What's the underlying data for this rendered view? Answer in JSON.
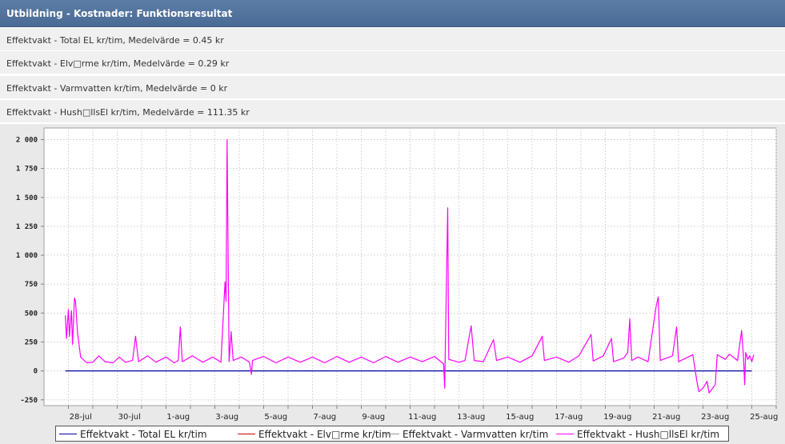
{
  "panel": {
    "title": "Utbildning - Kostnader: Funktionsresultat"
  },
  "summary_rows": [
    "Effektvakt - Total EL kr/tim, Medelvärde = 0.45 kr",
    "Effektvakt - Elv□rme kr/tim, Medelvärde = 0.29 kr",
    "Effektvakt - Varmvatten kr/tim, Medelvärde = 0 kr",
    "Effektvakt - Hush□llsEl kr/tim, Medelvärde = 111.35 kr"
  ],
  "chart_data": {
    "type": "line",
    "x_unit": "day",
    "x_tick_labels": [
      "28-jul",
      "30-jul",
      "1-aug",
      "3-aug",
      "5-aug",
      "7-aug",
      "9-aug",
      "11-aug",
      "13-aug",
      "15-aug",
      "17-aug",
      "19-aug",
      "21-aug",
      "23-aug",
      "25-aug"
    ],
    "x_range": [
      "2023-07-26T12:00",
      "2023-08-25T12:00"
    ],
    "y_ticks": [
      2000,
      1750,
      1500,
      1250,
      1000,
      750,
      500,
      250,
      0,
      -250
    ],
    "y_tick_labels": [
      "2 000",
      "1 750",
      "1 500",
      "1 250",
      "1 000",
      "750",
      "500",
      "250",
      "0",
      "-250"
    ],
    "ylim": [
      -300,
      2100
    ],
    "grid": true,
    "legend_position": "bottom",
    "series": [
      {
        "name": "Effektvakt - Total EL kr/tim",
        "color": "#0000a0",
        "points": [
          [
            "2023-07-27T09:00",
            0
          ],
          [
            "2023-08-24T12:00",
            0
          ]
        ]
      },
      {
        "name": "Effektvakt - Elv□rme kr/tim",
        "color": "#cc0000",
        "points": []
      },
      {
        "name": "Effektvakt - Varmvatten kr/tim",
        "color": "#999999",
        "points": []
      },
      {
        "name": "Effektvakt - Hush□llsEl kr/tim",
        "color": "#ff00ff",
        "points": [
          [
            "2023-07-27T09:00",
            480
          ],
          [
            "2023-07-27T10:00",
            280
          ],
          [
            "2023-07-27T12:00",
            530
          ],
          [
            "2023-07-27T13:00",
            300
          ],
          [
            "2023-07-27T15:00",
            520
          ],
          [
            "2023-07-27T16:00",
            230
          ],
          [
            "2023-07-27T18:00",
            630
          ],
          [
            "2023-07-27T19:00",
            600
          ],
          [
            "2023-07-27T21:00",
            330
          ],
          [
            "2023-07-28T00:00",
            120
          ],
          [
            "2023-07-28T06:00",
            70
          ],
          [
            "2023-07-28T12:00",
            75
          ],
          [
            "2023-07-28T18:00",
            130
          ],
          [
            "2023-07-29T00:00",
            80
          ],
          [
            "2023-07-29T08:00",
            70
          ],
          [
            "2023-07-29T14:00",
            120
          ],
          [
            "2023-07-29T20:00",
            75
          ],
          [
            "2023-07-30T03:00",
            90
          ],
          [
            "2023-07-30T06:00",
            300
          ],
          [
            "2023-07-30T09:00",
            80
          ],
          [
            "2023-07-30T18:00",
            130
          ],
          [
            "2023-07-31T02:00",
            75
          ],
          [
            "2023-07-31T12:00",
            120
          ],
          [
            "2023-07-31T20:00",
            70
          ],
          [
            "2023-08-01T00:00",
            90
          ],
          [
            "2023-08-01T02:00",
            380
          ],
          [
            "2023-08-01T04:00",
            80
          ],
          [
            "2023-08-01T14:00",
            130
          ],
          [
            "2023-08-02T00:00",
            75
          ],
          [
            "2023-08-02T10:00",
            120
          ],
          [
            "2023-08-02T18:00",
            75
          ],
          [
            "2023-08-02T22:00",
            770
          ],
          [
            "2023-08-02T23:00",
            600
          ],
          [
            "2023-08-03T00:00",
            2000
          ],
          [
            "2023-08-03T02:00",
            80
          ],
          [
            "2023-08-03T04:00",
            340
          ],
          [
            "2023-08-03T06:00",
            90
          ],
          [
            "2023-08-03T14:00",
            120
          ],
          [
            "2023-08-03T22:00",
            75
          ],
          [
            "2023-08-04T00:00",
            -30
          ],
          [
            "2023-08-04T01:00",
            90
          ],
          [
            "2023-08-04T12:00",
            125
          ],
          [
            "2023-08-05T00:00",
            70
          ],
          [
            "2023-08-05T12:00",
            120
          ],
          [
            "2023-08-06T00:00",
            75
          ],
          [
            "2023-08-06T12:00",
            120
          ],
          [
            "2023-08-07T00:00",
            70
          ],
          [
            "2023-08-07T12:00",
            125
          ],
          [
            "2023-08-08T00:00",
            75
          ],
          [
            "2023-08-08T12:00",
            120
          ],
          [
            "2023-08-09T00:00",
            70
          ],
          [
            "2023-08-09T12:00",
            125
          ],
          [
            "2023-08-10T00:00",
            75
          ],
          [
            "2023-08-10T12:00",
            120
          ],
          [
            "2023-08-11T00:00",
            80
          ],
          [
            "2023-08-11T12:00",
            125
          ],
          [
            "2023-08-11T21:00",
            60
          ],
          [
            "2023-08-11T22:00",
            -150
          ],
          [
            "2023-08-11T23:00",
            400
          ],
          [
            "2023-08-12T01:00",
            1410
          ],
          [
            "2023-08-12T02:00",
            100
          ],
          [
            "2023-08-12T12:00",
            75
          ],
          [
            "2023-08-12T18:00",
            90
          ],
          [
            "2023-08-13T00:00",
            390
          ],
          [
            "2023-08-13T03:00",
            90
          ],
          [
            "2023-08-13T12:00",
            80
          ],
          [
            "2023-08-13T22:00",
            270
          ],
          [
            "2023-08-14T01:00",
            90
          ],
          [
            "2023-08-14T12:00",
            120
          ],
          [
            "2023-08-15T00:00",
            75
          ],
          [
            "2023-08-15T12:00",
            130
          ],
          [
            "2023-08-15T22:00",
            300
          ],
          [
            "2023-08-16T00:00",
            90
          ],
          [
            "2023-08-16T12:00",
            120
          ],
          [
            "2023-08-17T00:00",
            75
          ],
          [
            "2023-08-17T10:00",
            130
          ],
          [
            "2023-08-17T22:00",
            315
          ],
          [
            "2023-08-18T00:00",
            85
          ],
          [
            "2023-08-18T10:00",
            130
          ],
          [
            "2023-08-18T18:00",
            280
          ],
          [
            "2023-08-18T20:00",
            80
          ],
          [
            "2023-08-19T06:00",
            110
          ],
          [
            "2023-08-19T10:00",
            160
          ],
          [
            "2023-08-19T12:00",
            450
          ],
          [
            "2023-08-19T14:00",
            90
          ],
          [
            "2023-08-19T20:00",
            120
          ],
          [
            "2023-08-20T06:00",
            80
          ],
          [
            "2023-08-20T14:00",
            560
          ],
          [
            "2023-08-20T16:00",
            640
          ],
          [
            "2023-08-20T18:00",
            90
          ],
          [
            "2023-08-21T06:00",
            130
          ],
          [
            "2023-08-21T10:00",
            380
          ],
          [
            "2023-08-21T12:00",
            80
          ],
          [
            "2023-08-22T02:00",
            140
          ],
          [
            "2023-08-22T06:00",
            -90
          ],
          [
            "2023-08-22T08:00",
            -180
          ],
          [
            "2023-08-22T12:00",
            -150
          ],
          [
            "2023-08-22T16:00",
            -90
          ],
          [
            "2023-08-22T18:00",
            -190
          ],
          [
            "2023-08-23T00:00",
            -120
          ],
          [
            "2023-08-23T02:00",
            140
          ],
          [
            "2023-08-23T10:00",
            100
          ],
          [
            "2023-08-23T14:00",
            145
          ],
          [
            "2023-08-23T22:00",
            90
          ],
          [
            "2023-08-24T02:00",
            350
          ],
          [
            "2023-08-24T04:00",
            100
          ],
          [
            "2023-08-24T05:00",
            -120
          ],
          [
            "2023-08-24T06:00",
            160
          ],
          [
            "2023-08-24T08:00",
            100
          ],
          [
            "2023-08-24T10:00",
            130
          ],
          [
            "2023-08-24T12:00",
            80
          ],
          [
            "2023-08-24T14:00",
            140
          ]
        ]
      }
    ]
  }
}
